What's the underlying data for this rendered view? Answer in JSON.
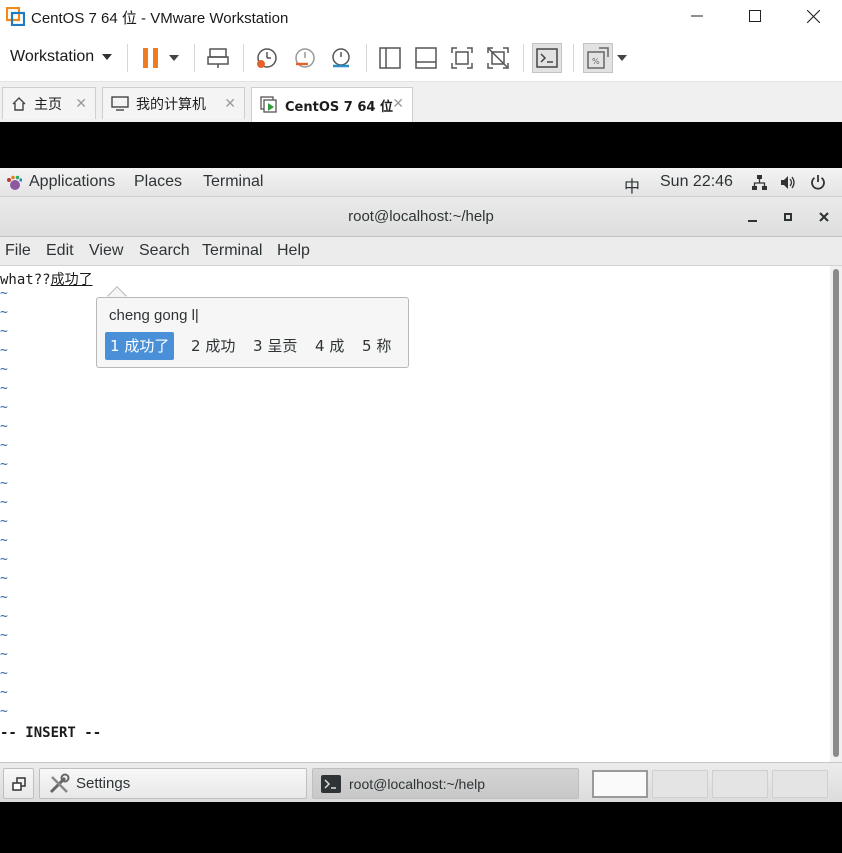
{
  "window": {
    "title": "CentOS 7 64 位 - VMware Workstation",
    "minimize_icon": "minimize-icon",
    "maximize_icon": "maximize-icon",
    "close_icon": "close-icon"
  },
  "toolbar": {
    "workstation_label": "Workstation",
    "icons": [
      "pause-icon",
      "send-ctrl-alt-del-icon",
      "snapshot-icon",
      "revert-snapshot-icon",
      "snapshot-manager-icon",
      "sidebar-icon",
      "thumbnail-bar-icon",
      "full-screen-icon",
      "unity-icon",
      "console-view-icon",
      "stretch-guest-icon"
    ]
  },
  "tabs": [
    {
      "label": "主页",
      "icon": "home-icon",
      "active": false
    },
    {
      "label": "我的计算机",
      "icon": "computer-icon",
      "active": false
    },
    {
      "label": "CentOS 7 64 位",
      "icon": "vm-running-icon",
      "active": true
    }
  ],
  "gnome_bar": {
    "applications": "Applications",
    "places": "Places",
    "terminal": "Terminal",
    "input_method": "中",
    "clock": "Sun 22:46",
    "network_icon": "network-icon",
    "volume_icon": "volume-icon",
    "power_icon": "power-icon"
  },
  "terminal": {
    "title": "root@localhost:~/help",
    "menu": [
      "File",
      "Edit",
      "View",
      "Search",
      "Terminal",
      "Help"
    ],
    "typed_text": "what??",
    "preedit_text": "成功了",
    "tilde_lines": 23,
    "mode_line": "-- INSERT --"
  },
  "ime": {
    "pinyin": "cheng gong l|",
    "candidates": [
      {
        "index": "1",
        "text": "成功了",
        "selected": true
      },
      {
        "index": "2",
        "text": "成功",
        "selected": false
      },
      {
        "index": "3",
        "text": "呈贡",
        "selected": false
      },
      {
        "index": "4",
        "text": "成",
        "selected": false
      },
      {
        "index": "5",
        "text": "称",
        "selected": false
      }
    ]
  },
  "bottom_panel": {
    "settings_label": "Settings",
    "terminal_task_label": "root@localhost:~/help",
    "workspaces": 4,
    "current_workspace": 1
  },
  "colors": {
    "accent": "#4a90d9",
    "pause_orange": "#f07c1f",
    "tilde_blue": "#3465a4"
  }
}
